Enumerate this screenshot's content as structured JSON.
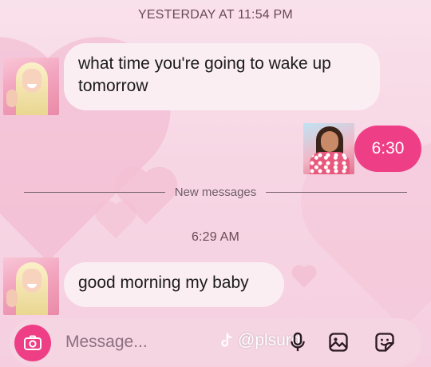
{
  "thread": {
    "timestamp_1": "YESTERDAY AT 11:54 PM",
    "timestamp_2": "6:29 AM",
    "divider_label": "New messages",
    "messages": [
      {
        "direction": "incoming",
        "text": "what time you're going to wake up tomorrow"
      },
      {
        "direction": "outgoing",
        "text": "6:30"
      },
      {
        "direction": "incoming",
        "text": "good morning my baby"
      }
    ]
  },
  "composer": {
    "placeholder": "Message...",
    "watermark": "@plsurd",
    "icons": [
      "camera-icon",
      "microphone-icon",
      "gallery-icon",
      "sticker-icon"
    ]
  },
  "colors": {
    "accent": "#ee3f86",
    "background": "#f8dbe7",
    "incoming_bubble": "#fbeef3"
  }
}
